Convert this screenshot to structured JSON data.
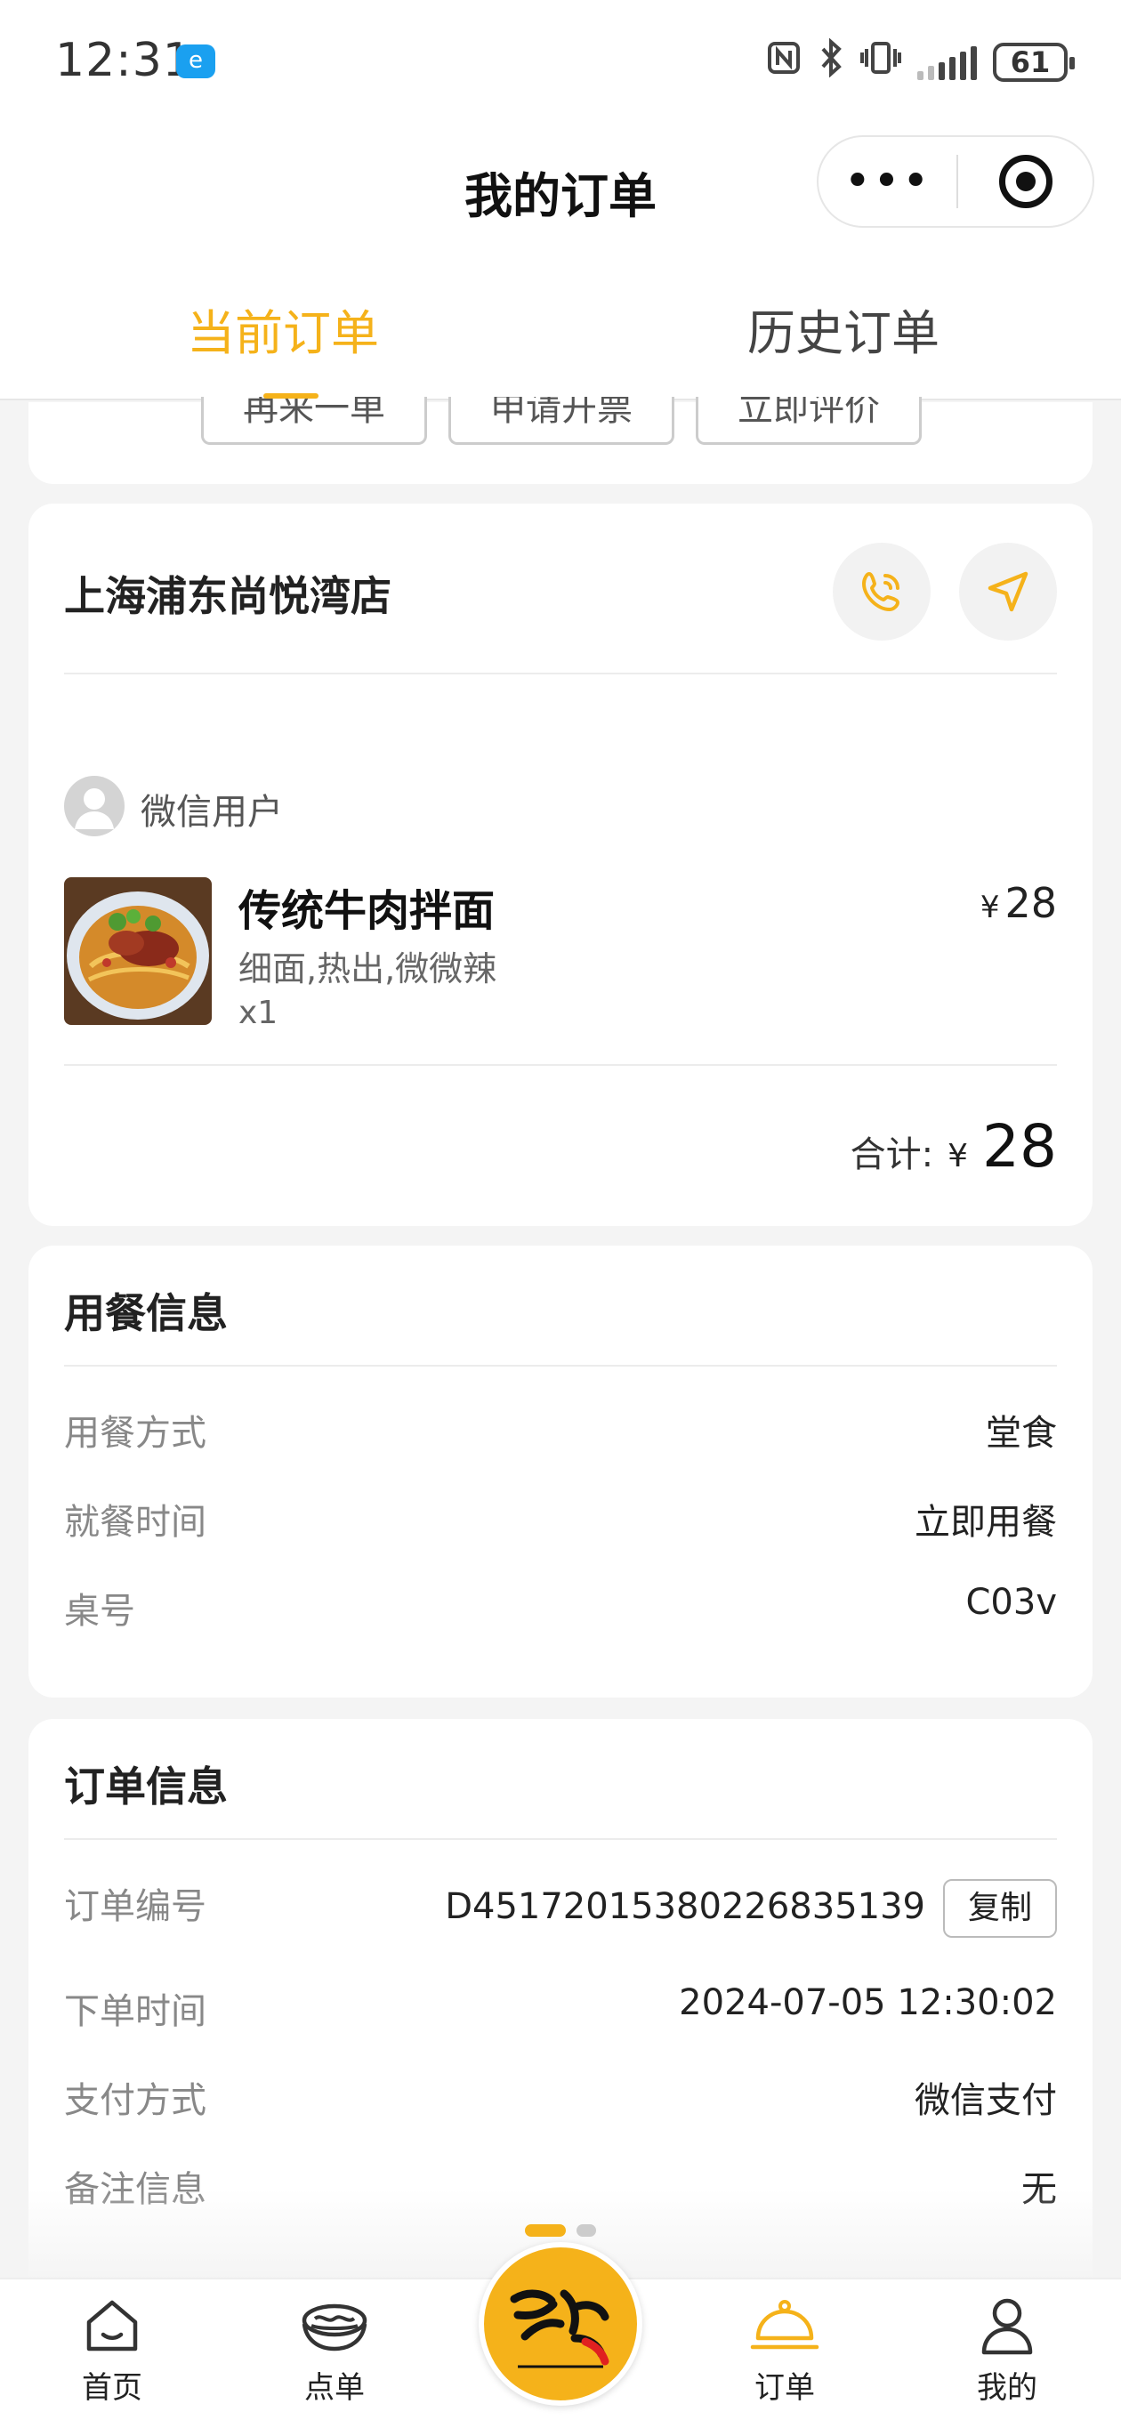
{
  "status_bar": {
    "time": "12:31",
    "app_badge": "e",
    "battery": "61"
  },
  "header": {
    "title": "我的订单",
    "more_label": "•••"
  },
  "tabs": {
    "current": "当前订单",
    "history": "历史订单"
  },
  "prev_card_buttons": [
    "再来一单",
    "申请开票",
    "立即评价"
  ],
  "order": {
    "store_name": "上海浦东尚悦湾店",
    "user_name": "微信用户",
    "item": {
      "name": "传统牛肉拌面",
      "spec": "细面,热出,微微辣",
      "qty": "x1",
      "currency": "¥",
      "price": "28"
    },
    "total_label": "合计:",
    "total_currency": "¥",
    "total": "28"
  },
  "dining_info": {
    "title": "用餐信息",
    "rows": [
      {
        "label": "用餐方式",
        "value": "堂食"
      },
      {
        "label": "就餐时间",
        "value": "立即用餐"
      },
      {
        "label": "桌号",
        "value": "C03v"
      }
    ]
  },
  "order_info": {
    "title": "订单信息",
    "order_no_label": "订单编号",
    "order_no": "D45172015380226835139",
    "copy_label": "复制",
    "rows": [
      {
        "label": "下单时间",
        "value": "2024-07-05 12:30:02"
      },
      {
        "label": "支付方式",
        "value": "微信支付"
      },
      {
        "label": "备注信息",
        "value": "无"
      }
    ]
  },
  "bottom_nav": {
    "home": "首页",
    "menu": "点单",
    "orders": "订单",
    "mine": "我的",
    "active": "orders",
    "accent_color": "#f5b21a"
  }
}
